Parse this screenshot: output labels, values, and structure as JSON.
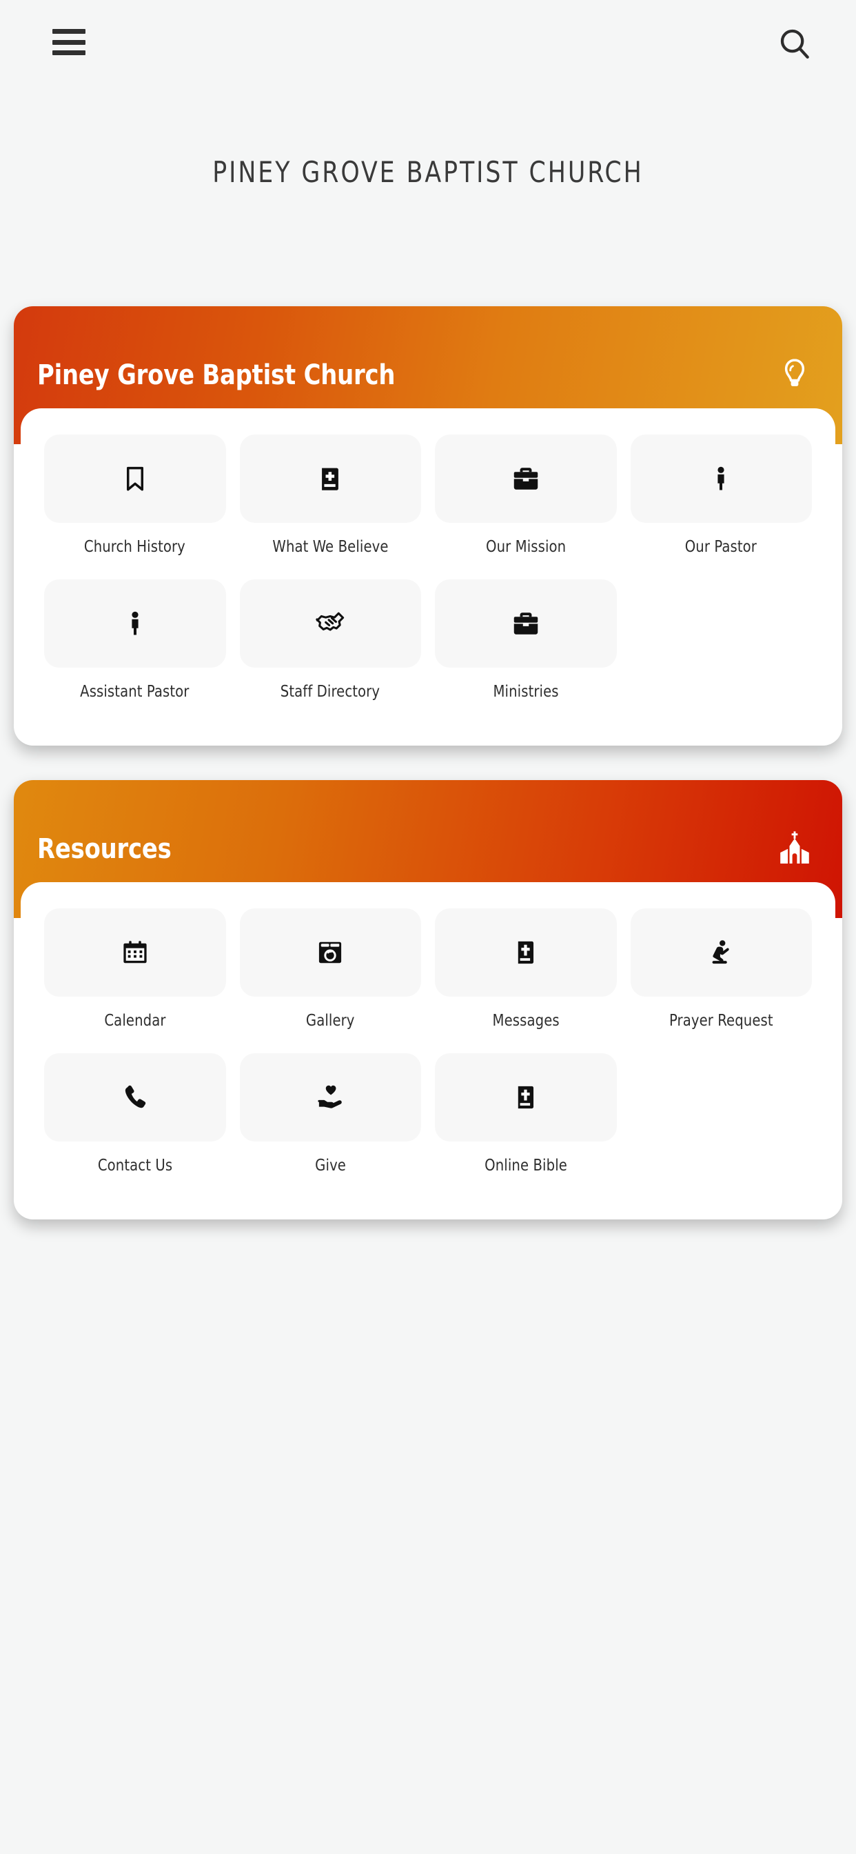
{
  "header": {
    "menu_icon": "hamburger-menu-icon",
    "search_icon": "search-icon",
    "site_title": "PINEY GROVE BAPTIST CHURCH"
  },
  "theme": {
    "page_background": "#f5f6f6",
    "card_background": "#ffffff",
    "tile_background": "#f7f7f7",
    "text_color": "#2e2e2e",
    "gradient_a_start": "#d43a0d",
    "gradient_a_end": "#e3a01e",
    "gradient_b_start": "#e0890f",
    "gradient_b_end": "#cf1403"
  },
  "cards": [
    {
      "title": "Piney Grove Baptist Church",
      "header_icon": "lightbulb-icon",
      "tiles": [
        {
          "label": "Church History",
          "icon": "bookmark-icon"
        },
        {
          "label": "What We Believe",
          "icon": "book-cross-icon"
        },
        {
          "label": "Our Mission",
          "icon": "briefcase-icon"
        },
        {
          "label": "Our Pastor",
          "icon": "person-icon"
        },
        {
          "label": "Assistant Pastor",
          "icon": "person-icon"
        },
        {
          "label": "Staff Directory",
          "icon": "handshake-icon"
        },
        {
          "label": "Ministries",
          "icon": "briefcase-icon"
        }
      ]
    },
    {
      "title": "Resources",
      "header_icon": "church-icon",
      "tiles": [
        {
          "label": "Calendar",
          "icon": "calendar-icon"
        },
        {
          "label": "Gallery",
          "icon": "camera-icon"
        },
        {
          "label": "Messages",
          "icon": "bible-icon"
        },
        {
          "label": "Prayer Request",
          "icon": "praying-person-icon"
        },
        {
          "label": "Contact Us",
          "icon": "phone-icon"
        },
        {
          "label": "Give",
          "icon": "hand-heart-icon"
        },
        {
          "label": "Online Bible",
          "icon": "bible-icon"
        }
      ]
    }
  ]
}
